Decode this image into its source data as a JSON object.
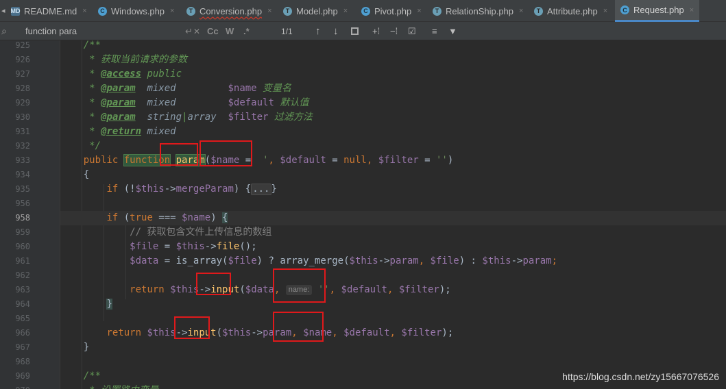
{
  "tabs": [
    {
      "label": "README.md",
      "icon": "markdown-file-icon",
      "icon_text": "MD"
    },
    {
      "label": "Windows.php",
      "icon": "php-class-icon",
      "icon_text": "C"
    },
    {
      "label": "Conversion.php",
      "icon": "php-file-icon",
      "icon_text": "T"
    },
    {
      "label": "Model.php",
      "icon": "php-file-icon",
      "icon_text": "T"
    },
    {
      "label": "Pivot.php",
      "icon": "php-class-icon",
      "icon_text": "C"
    },
    {
      "label": "RelationShip.php",
      "icon": "php-file-icon",
      "icon_text": "T"
    },
    {
      "label": "Attribute.php",
      "icon": "php-file-icon",
      "icon_text": "T"
    },
    {
      "label": "Request.php",
      "icon": "php-class-icon",
      "icon_text": "C"
    }
  ],
  "tab_close_glyph": "×",
  "find": {
    "search_icon_glyph": "⌕",
    "query": "function para",
    "match_case": "Cc",
    "words": "W",
    "regex": ".*",
    "count": "1/1"
  },
  "lines": [
    {
      "n": "925",
      "segments": [
        {
          "t": "    /**",
          "c": "doc"
        }
      ]
    },
    {
      "n": "926",
      "segments": [
        {
          "t": "     * 获取当前请求的参数",
          "c": "doc"
        }
      ]
    },
    {
      "n": "927",
      "segments": [
        {
          "t": "     * ",
          "c": "doc"
        },
        {
          "t": "@access",
          "c": "tag"
        },
        {
          "t": " public",
          "c": "doc"
        }
      ]
    },
    {
      "n": "928",
      "segments": [
        {
          "t": "     * ",
          "c": "doc"
        },
        {
          "t": "@param",
          "c": "tag"
        },
        {
          "t": "  mixed",
          "c": "dtype"
        },
        {
          "t": "         ",
          "c": "doc"
        },
        {
          "t": "$name",
          "c": "var"
        },
        {
          "t": " 变量名",
          "c": "doc"
        }
      ]
    },
    {
      "n": "929",
      "segments": [
        {
          "t": "     * ",
          "c": "doc"
        },
        {
          "t": "@param",
          "c": "tag"
        },
        {
          "t": "  mixed",
          "c": "dtype"
        },
        {
          "t": "         ",
          "c": "doc"
        },
        {
          "t": "$default",
          "c": "var"
        },
        {
          "t": " 默认值",
          "c": "doc"
        }
      ]
    },
    {
      "n": "930",
      "segments": [
        {
          "t": "     * ",
          "c": "doc"
        },
        {
          "t": "@param",
          "c": "tag"
        },
        {
          "t": "  string",
          "c": "dtype"
        },
        {
          "t": "|",
          "c": "doc"
        },
        {
          "t": "array",
          "c": "dtype"
        },
        {
          "t": "  ",
          "c": "doc"
        },
        {
          "t": "$filter",
          "c": "var"
        },
        {
          "t": " 过滤方法",
          "c": "doc"
        }
      ]
    },
    {
      "n": "931",
      "segments": [
        {
          "t": "     * ",
          "c": "doc"
        },
        {
          "t": "@return",
          "c": "tag"
        },
        {
          "t": " mixed",
          "c": "dtype"
        }
      ]
    },
    {
      "n": "932",
      "segments": [
        {
          "t": "     */",
          "c": "doc"
        }
      ]
    },
    {
      "n": "933",
      "segments": [
        {
          "t": "    ",
          "c": ""
        },
        {
          "t": "public",
          "c": "kw"
        },
        {
          "t": " ",
          "c": ""
        },
        {
          "t": "function",
          "c": "kw hl-fn"
        },
        {
          "t": " ",
          "c": ""
        },
        {
          "t": "param",
          "c": "fn hl-fn"
        },
        {
          "t": "(",
          "c": ""
        },
        {
          "t": "$name",
          "c": "var"
        },
        {
          "t": " = ",
          "c": ""
        },
        {
          "t": " '",
          "c": "str"
        },
        {
          "t": ", ",
          "c": "kw"
        },
        {
          "t": "$default",
          "c": "var"
        },
        {
          "t": " = ",
          "c": ""
        },
        {
          "t": "null",
          "c": "kw"
        },
        {
          "t": ", ",
          "c": "kw"
        },
        {
          "t": "$filter",
          "c": "var"
        },
        {
          "t": " = ",
          "c": ""
        },
        {
          "t": "''",
          "c": "str"
        },
        {
          "t": ")",
          "c": ""
        }
      ]
    },
    {
      "n": "934",
      "segments": [
        {
          "t": "    {",
          "c": ""
        }
      ]
    },
    {
      "n": "935",
      "segments": [
        {
          "t": "        ",
          "c": ""
        },
        {
          "t": "if",
          "c": "kw"
        },
        {
          "t": " (!",
          "c": ""
        },
        {
          "t": "$this",
          "c": "var"
        },
        {
          "t": "->",
          "c": ""
        },
        {
          "t": "mergeParam",
          "c": "var"
        },
        {
          "t": ") {",
          "c": ""
        },
        {
          "t": "...",
          "c": "fold"
        },
        {
          "t": "}",
          "c": ""
        }
      ]
    },
    {
      "n": "956",
      "segments": []
    },
    {
      "n": "958",
      "segments": [
        {
          "t": "        ",
          "c": ""
        },
        {
          "t": "if",
          "c": "kw"
        },
        {
          "t": " (",
          "c": ""
        },
        {
          "t": "true",
          "c": "kw"
        },
        {
          "t": " === ",
          "c": ""
        },
        {
          "t": "$name",
          "c": "var"
        },
        {
          "t": ") ",
          "c": ""
        },
        {
          "t": "{",
          "c": "brace-hl"
        }
      ]
    },
    {
      "n": "959",
      "segments": [
        {
          "t": "            // 获取包含文件上传信息的数组",
          "c": "cmt"
        }
      ]
    },
    {
      "n": "960",
      "segments": [
        {
          "t": "            ",
          "c": ""
        },
        {
          "t": "$file",
          "c": "var"
        },
        {
          "t": " = ",
          "c": ""
        },
        {
          "t": "$this",
          "c": "var"
        },
        {
          "t": "->",
          "c": ""
        },
        {
          "t": "file",
          "c": "fn"
        },
        {
          "t": "();",
          "c": ""
        }
      ]
    },
    {
      "n": "961",
      "segments": [
        {
          "t": "            ",
          "c": ""
        },
        {
          "t": "$data",
          "c": "var"
        },
        {
          "t": " = ",
          "c": ""
        },
        {
          "t": "is_array",
          "c": ""
        },
        {
          "t": "(",
          "c": ""
        },
        {
          "t": "$file",
          "c": "var"
        },
        {
          "t": ") ? ",
          "c": ""
        },
        {
          "t": "array_merge",
          "c": ""
        },
        {
          "t": "(",
          "c": ""
        },
        {
          "t": "$this",
          "c": "var"
        },
        {
          "t": "->",
          "c": ""
        },
        {
          "t": "param",
          "c": "var"
        },
        {
          "t": ", ",
          "c": "kw"
        },
        {
          "t": "$file",
          "c": "var"
        },
        {
          "t": ") : ",
          "c": ""
        },
        {
          "t": "$this",
          "c": "var"
        },
        {
          "t": "->",
          "c": ""
        },
        {
          "t": "param",
          "c": "var"
        },
        {
          "t": ";",
          "c": "kw"
        }
      ]
    },
    {
      "n": "962",
      "segments": []
    },
    {
      "n": "963",
      "segments": [
        {
          "t": "            ",
          "c": ""
        },
        {
          "t": "return",
          "c": "kw"
        },
        {
          "t": " ",
          "c": ""
        },
        {
          "t": "$this",
          "c": "var"
        },
        {
          "t": "->",
          "c": ""
        },
        {
          "t": "input",
          "c": "fn"
        },
        {
          "t": "(",
          "c": ""
        },
        {
          "t": "$data",
          "c": "var"
        },
        {
          "t": ", ",
          "c": "kw"
        },
        {
          "t": "name:",
          "c": "hintbox"
        },
        {
          "t": " ",
          "c": ""
        },
        {
          "t": "''",
          "c": "str"
        },
        {
          "t": ", ",
          "c": "kw"
        },
        {
          "t": "$default",
          "c": "var"
        },
        {
          "t": ", ",
          "c": "kw"
        },
        {
          "t": "$filter",
          "c": "var"
        },
        {
          "t": ");",
          "c": ""
        }
      ]
    },
    {
      "n": "964",
      "segments": [
        {
          "t": "        ",
          "c": ""
        },
        {
          "t": "}",
          "c": "brace-hl"
        }
      ]
    },
    {
      "n": "965",
      "segments": []
    },
    {
      "n": "966",
      "segments": [
        {
          "t": "        ",
          "c": ""
        },
        {
          "t": "return",
          "c": "kw"
        },
        {
          "t": " ",
          "c": ""
        },
        {
          "t": "$this",
          "c": "var"
        },
        {
          "t": "->",
          "c": ""
        },
        {
          "t": "input",
          "c": "fn"
        },
        {
          "t": "(",
          "c": ""
        },
        {
          "t": "$this",
          "c": "var"
        },
        {
          "t": "->",
          "c": ""
        },
        {
          "t": "param",
          "c": "var"
        },
        {
          "t": ", ",
          "c": "kw"
        },
        {
          "t": "$name",
          "c": "var"
        },
        {
          "t": ", ",
          "c": "kw"
        },
        {
          "t": "$default",
          "c": "var"
        },
        {
          "t": ", ",
          "c": "kw"
        },
        {
          "t": "$filter",
          "c": "var"
        },
        {
          "t": ");",
          "c": ""
        }
      ]
    },
    {
      "n": "967",
      "segments": [
        {
          "t": "    }",
          "c": ""
        }
      ]
    },
    {
      "n": "968",
      "segments": []
    },
    {
      "n": "969",
      "segments": [
        {
          "t": "    /**",
          "c": "doc"
        }
      ]
    },
    {
      "n": "970",
      "segments": [
        {
          "t": "     * 设置路由变量",
          "c": "doc"
        }
      ]
    }
  ],
  "current_line": "958",
  "watermark": "https://blog.csdn.net/zy15667076526",
  "accent_color": "#4a88c7",
  "annotation_color": "#e0191b"
}
